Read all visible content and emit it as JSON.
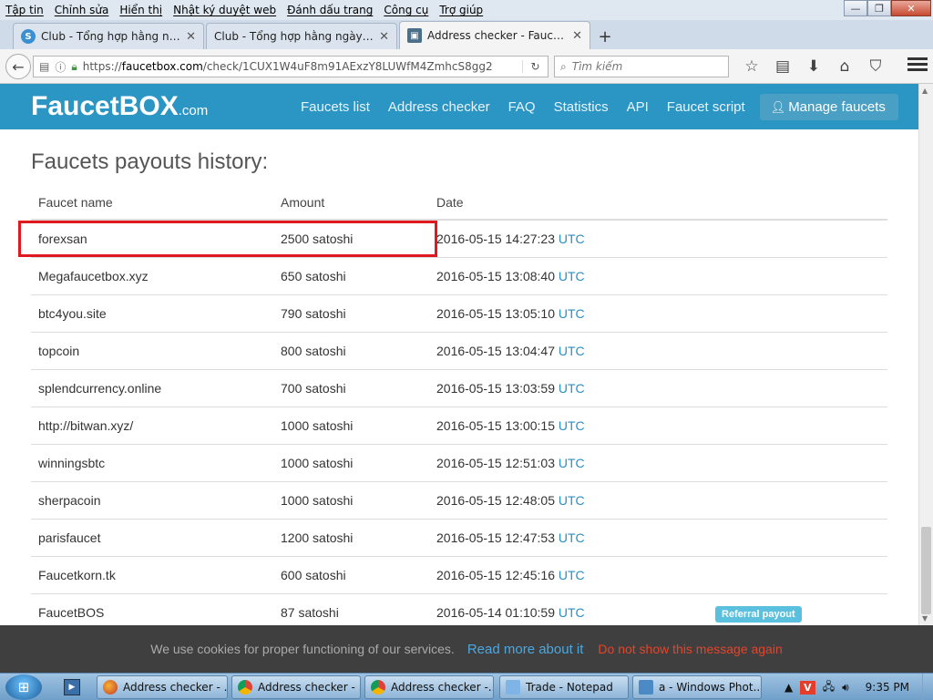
{
  "menubar": {
    "items": [
      "Tập tin",
      "Chỉnh sửa",
      "Hiển thị",
      "Nhật ký duyệt web",
      "Đánh dấu trang",
      "Công cụ",
      "Trợ giúp"
    ]
  },
  "window_controls": {
    "minimize": "—",
    "maximize": "❐",
    "close": "✕"
  },
  "tabs": [
    {
      "title": "Club - Tổng hợp hằng ngà...",
      "close": "✕",
      "icon": "S"
    },
    {
      "title": "Club - Tổng hợp hằng ngày cá...",
      "close": "✕",
      "icon": ""
    },
    {
      "title": "Address checker - FaucetB...",
      "close": "✕",
      "icon": "▣"
    }
  ],
  "new_tab_label": "+",
  "navbar": {
    "url_prefix": "https://",
    "url_domain": "faucetbox.com",
    "url_path": "/check/1CUX1W4uF8m91AExzY8LUWfM4ZmhcS8gg2",
    "search_placeholder": "Tìm kiếm"
  },
  "site": {
    "logo": "FaucetBOX",
    "logo_suffix": ".com",
    "nav": [
      "Faucets list",
      "Address checker",
      "FAQ",
      "Statistics",
      "API",
      "Faucet script"
    ],
    "manage_label": "Manage faucets"
  },
  "page": {
    "heading": "Faucets payouts history:",
    "columns": [
      "Faucet name",
      "Amount",
      "Date"
    ],
    "rows": [
      {
        "name": "forexsan",
        "amount": "2500 satoshi",
        "date": "2016-05-15 14:27:23",
        "tz": "UTC",
        "badge": "",
        "highlighted": true
      },
      {
        "name": "Megafaucetbox.xyz",
        "amount": "650 satoshi",
        "date": "2016-05-15 13:08:40",
        "tz": "UTC",
        "badge": ""
      },
      {
        "name": "btc4you.site",
        "amount": "790 satoshi",
        "date": "2016-05-15 13:05:10",
        "tz": "UTC",
        "badge": ""
      },
      {
        "name": "topcoin",
        "amount": "800 satoshi",
        "date": "2016-05-15 13:04:47",
        "tz": "UTC",
        "badge": ""
      },
      {
        "name": "splendcurrency.online",
        "amount": "700 satoshi",
        "date": "2016-05-15 13:03:59",
        "tz": "UTC",
        "badge": ""
      },
      {
        "name": "http://bitwan.xyz/",
        "amount": "1000 satoshi",
        "date": "2016-05-15 13:00:15",
        "tz": "UTC",
        "badge": ""
      },
      {
        "name": "winningsbtc",
        "amount": "1000 satoshi",
        "date": "2016-05-15 12:51:03",
        "tz": "UTC",
        "badge": ""
      },
      {
        "name": "sherpacoin",
        "amount": "1000 satoshi",
        "date": "2016-05-15 12:48:05",
        "tz": "UTC",
        "badge": ""
      },
      {
        "name": "parisfaucet",
        "amount": "1200 satoshi",
        "date": "2016-05-15 12:47:53",
        "tz": "UTC",
        "badge": ""
      },
      {
        "name": "Faucetkorn.tk",
        "amount": "600 satoshi",
        "date": "2016-05-15 12:45:16",
        "tz": "UTC",
        "badge": ""
      },
      {
        "name": "FaucetBOS",
        "amount": "87 satoshi",
        "date": "2016-05-14 01:10:59",
        "tz": "UTC",
        "badge": "Referral payout"
      }
    ]
  },
  "cookie_bar": {
    "text": "We use cookies for proper functioning of our services.",
    "link": "Read more about it",
    "dismiss": "Do not show this message again"
  },
  "taskbar": {
    "items": [
      {
        "label": "Address checker - ...",
        "icon": "firefox"
      },
      {
        "label": "Address checker - ...",
        "icon": "chrome"
      },
      {
        "label": "Address checker -...",
        "icon": "chrome"
      },
      {
        "label": "Trade - Notepad",
        "icon": "notepad"
      },
      {
        "label": "a - Windows Phot...",
        "icon": "photos"
      }
    ],
    "clock": "9:35 PM"
  },
  "colors": {
    "site_header": "#2b95c4",
    "utc_link": "#2a8fc4",
    "badge": "#5bc0de",
    "highlight_box": "#e0191e",
    "cookie_link": "#4aa8e0",
    "cookie_dismiss": "#e2452b"
  }
}
